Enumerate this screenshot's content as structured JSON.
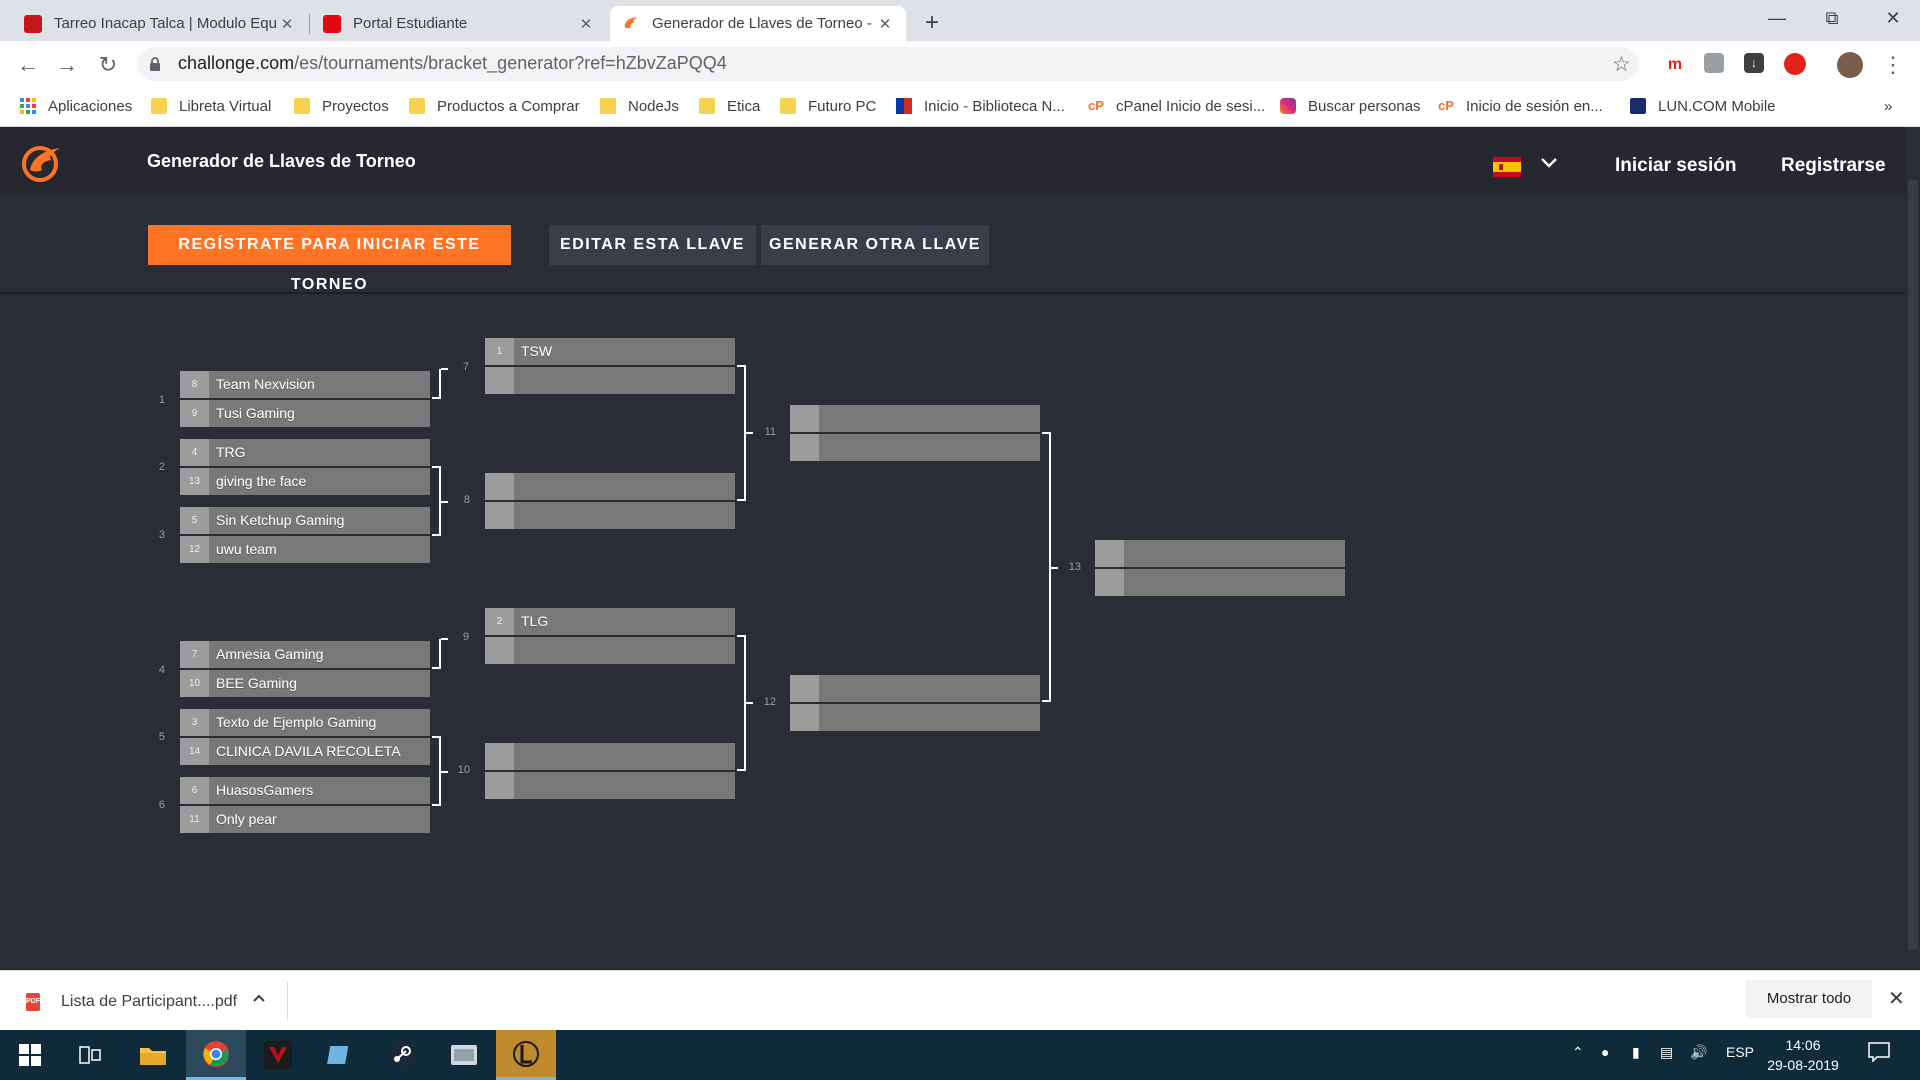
{
  "browser": {
    "tabs": [
      {
        "title": "Tarreo Inacap Talca | Modulo Equ",
        "close": "✕"
      },
      {
        "title": "Portal Estudiante",
        "close": "✕"
      },
      {
        "title": "Generador de Llaves de Torneo -",
        "close": "✕"
      }
    ],
    "new_tab": "+",
    "url_host": "challonge.com",
    "url_path": "/es/tournaments/bracket_generator?ref=hZbvZaPQQ4",
    "bookmarks": [
      "Aplicaciones",
      "Libreta Virtual",
      "Proyectos",
      "Productos a Comprar",
      "NodeJs",
      "Etica",
      "Futuro PC",
      "Inicio - Biblioteca N...",
      "cPanel Inicio de sesi...",
      "Buscar personas",
      "Inicio de sesión en...",
      "LUN.COM Mobile"
    ],
    "bookmarks_more": "»"
  },
  "site": {
    "title": "Generador de Llaves de Torneo",
    "login": "Iniciar sesión",
    "register": "Registrarse",
    "buttons": {
      "register_start": "REGÍSTRATE PARA INICIAR ESTE TORNEO",
      "edit": "EDITAR ESTA LLAVE",
      "generate": "GENERAR OTRA LLAVE"
    },
    "colors": {
      "accent": "#ff7324",
      "bg": "#2b2d36",
      "header": "#26272f"
    }
  },
  "bracket": {
    "round1": [
      {
        "num": "1",
        "p1": {
          "seed": "8",
          "name": "Team Nexvision"
        },
        "p2": {
          "seed": "9",
          "name": "Tusi Gaming"
        }
      },
      {
        "num": "2",
        "p1": {
          "seed": "4",
          "name": "TRG"
        },
        "p2": {
          "seed": "13",
          "name": "giving the face"
        }
      },
      {
        "num": "3",
        "p1": {
          "seed": "5",
          "name": "Sin Ketchup Gaming"
        },
        "p2": {
          "seed": "12",
          "name": "uwu team"
        }
      },
      {
        "num": "4",
        "p1": {
          "seed": "7",
          "name": "Amnesia Gaming"
        },
        "p2": {
          "seed": "10",
          "name": "BEE Gaming"
        }
      },
      {
        "num": "5",
        "p1": {
          "seed": "3",
          "name": "Texto de Ejemplo Gaming"
        },
        "p2": {
          "seed": "14",
          "name": "CLINICA DAVILA RECOLETA"
        }
      },
      {
        "num": "6",
        "p1": {
          "seed": "6",
          "name": "HuasosGamers"
        },
        "p2": {
          "seed": "11",
          "name": "Only pear"
        }
      }
    ],
    "round2": [
      {
        "num": "7",
        "p1": {
          "seed": "1",
          "name": "TSW"
        }
      },
      {
        "num": "8"
      },
      {
        "num": "9",
        "p1": {
          "seed": "2",
          "name": "TLG"
        }
      },
      {
        "num": "10"
      }
    ],
    "round3": [
      {
        "num": "11"
      },
      {
        "num": "12"
      }
    ],
    "final": {
      "num": "13"
    }
  },
  "download": {
    "file": "Lista de Participant....pdf",
    "icon_label": "PDF",
    "show_all": "Mostrar todo"
  },
  "taskbar": {
    "lang": "ESP",
    "time": "14:06",
    "date": "29-08-2019"
  }
}
